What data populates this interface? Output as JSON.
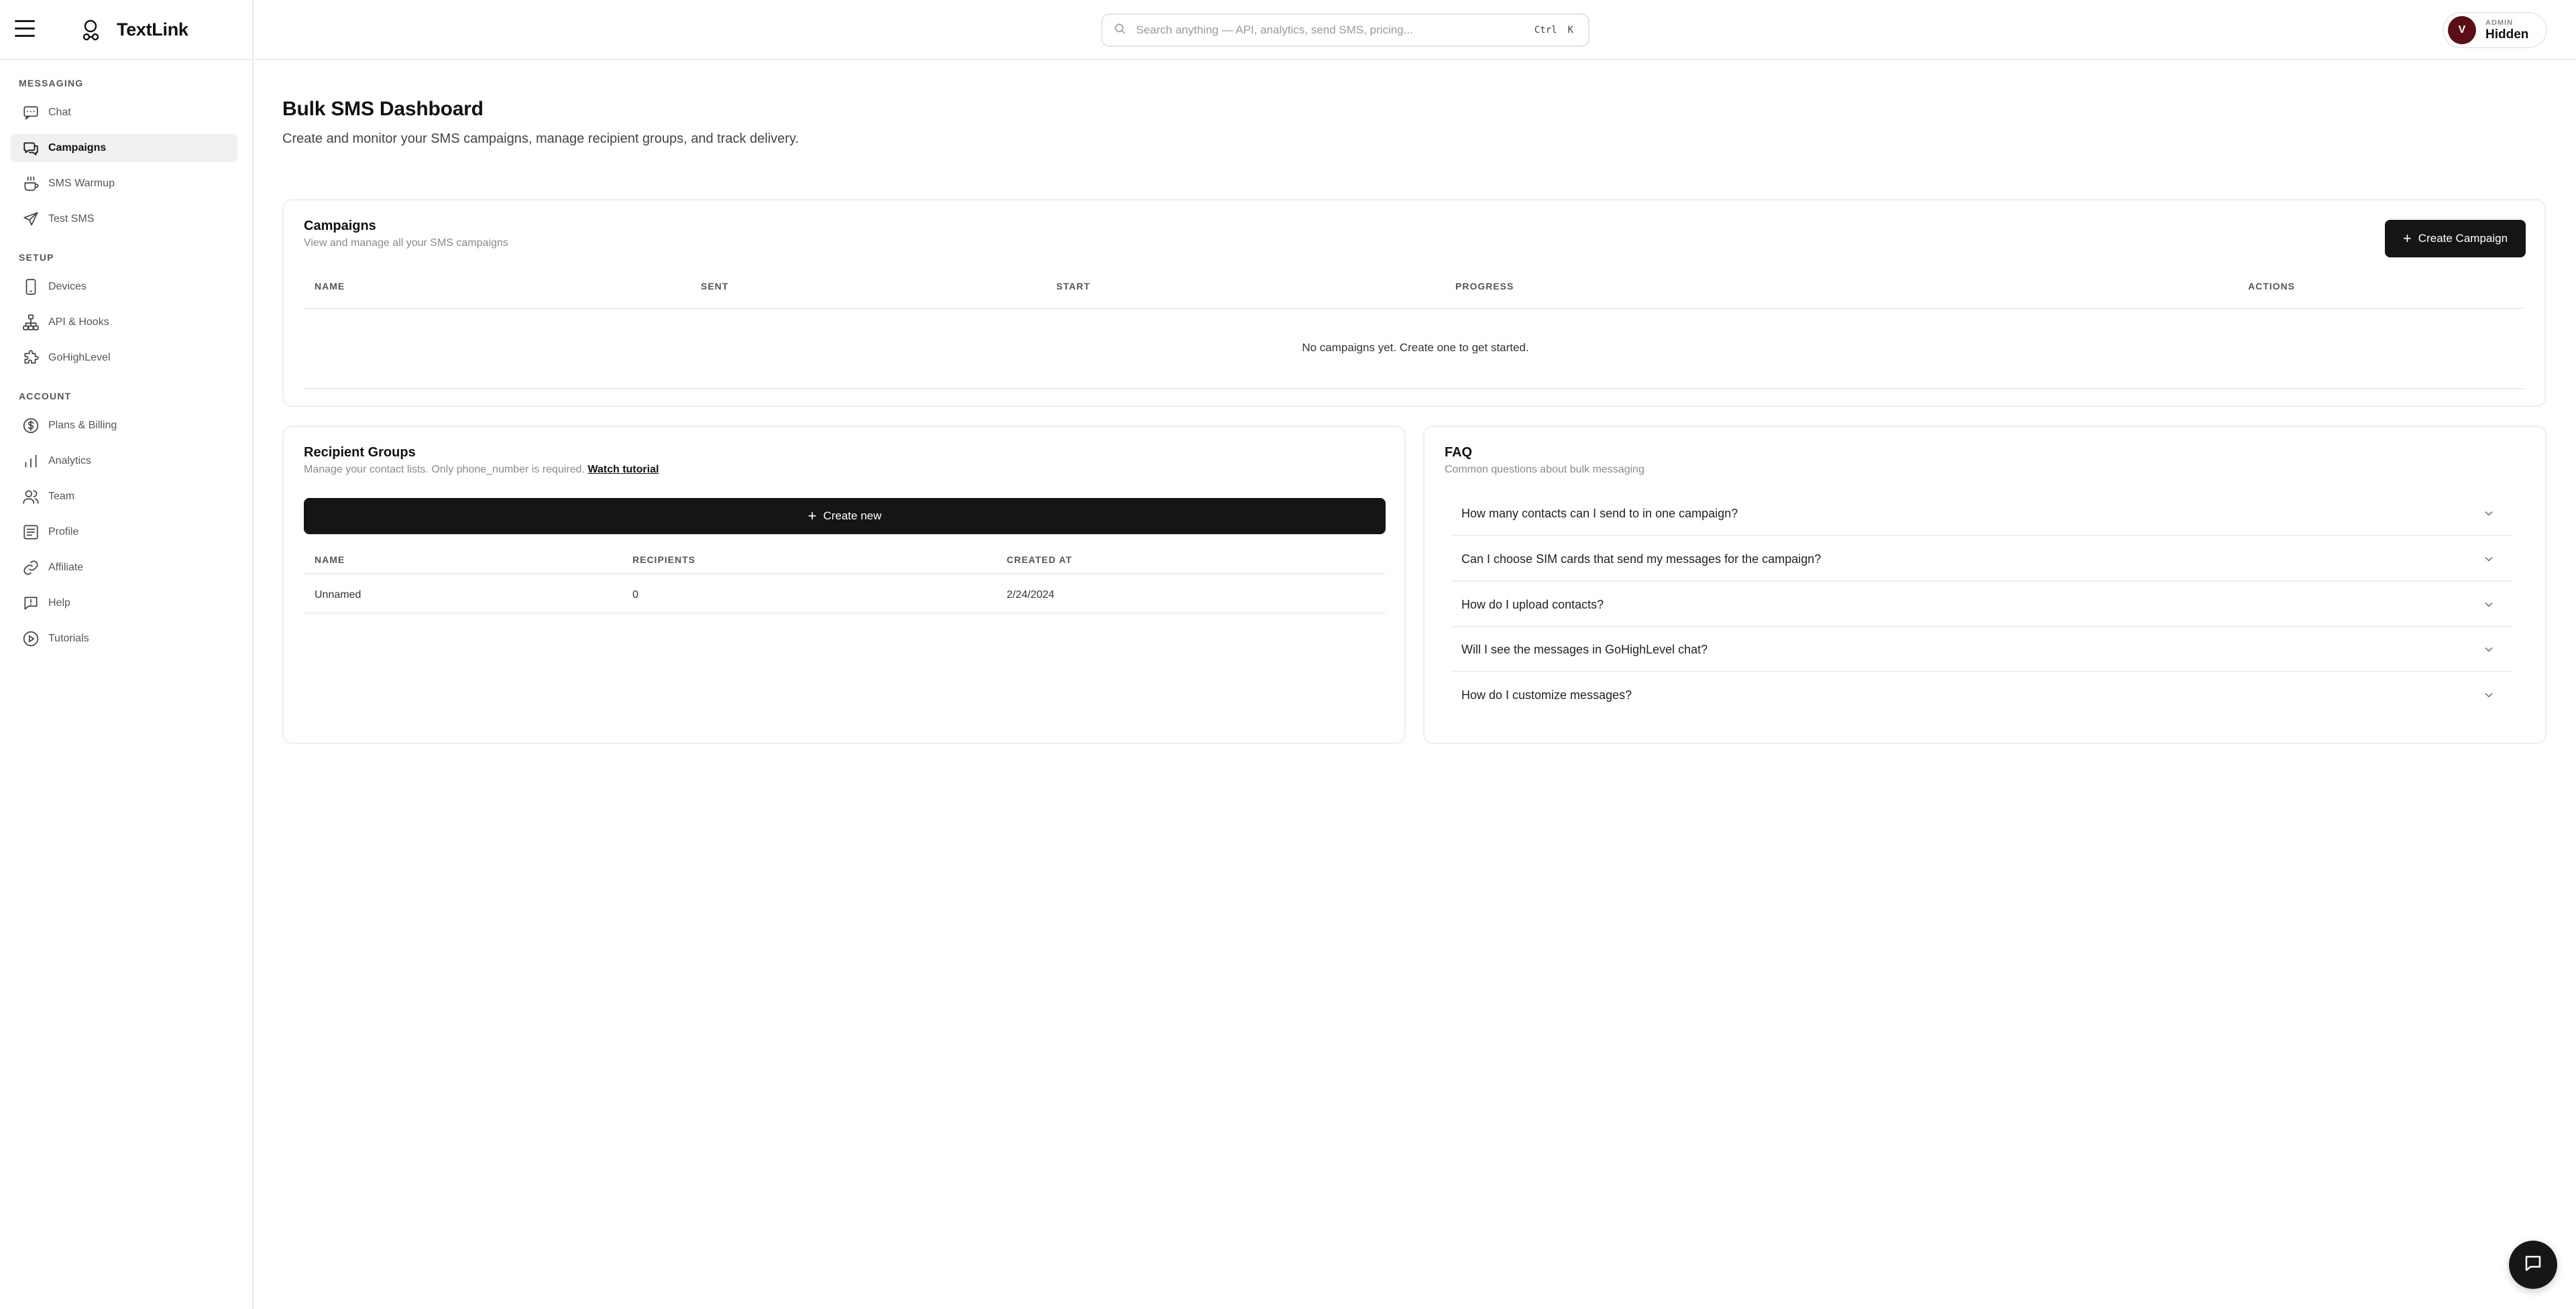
{
  "app": {
    "name": "TextLink"
  },
  "sidebar": {
    "sections": [
      {
        "label": "MESSAGING"
      },
      {
        "label": "SETUP"
      },
      {
        "label": "ACCOUNT"
      }
    ],
    "items": [
      {
        "label": "Chat",
        "icon": "chat-icon"
      },
      {
        "label": "Campaigns",
        "icon": "campaigns-icon",
        "active": true
      },
      {
        "label": "SMS Warmup",
        "icon": "warmup-icon"
      },
      {
        "label": "Test SMS",
        "icon": "send-icon"
      },
      {
        "label": "Devices",
        "icon": "phone-icon"
      },
      {
        "label": "API & Hooks",
        "icon": "network-icon"
      },
      {
        "label": "GoHighLevel",
        "icon": "puzzle-icon"
      },
      {
        "label": "Plans & Billing",
        "icon": "dollar-icon"
      },
      {
        "label": "Analytics",
        "icon": "bar-chart-icon"
      },
      {
        "label": "Team",
        "icon": "team-icon"
      },
      {
        "label": "Profile",
        "icon": "profile-icon"
      },
      {
        "label": "Affiliate",
        "icon": "link-icon"
      },
      {
        "label": "Help",
        "icon": "help-icon"
      },
      {
        "label": "Tutorials",
        "icon": "play-icon"
      }
    ]
  },
  "search": {
    "placeholder": "Search anything — API, analytics, send SMS, pricing...",
    "shortcut_mod": "Ctrl",
    "shortcut_key": "K"
  },
  "user": {
    "initial": "V",
    "role": "ADMIN",
    "name": "Hidden"
  },
  "page": {
    "title": "Bulk SMS Dashboard",
    "subtitle": "Create and monitor your SMS campaigns, manage recipient groups, and track delivery."
  },
  "campaigns": {
    "title": "Campaigns",
    "subtitle": "View and manage all your SMS campaigns",
    "create_label": "Create Campaign",
    "columns": [
      "NAME",
      "SENT",
      "START",
      "PROGRESS",
      "ACTIONS"
    ],
    "empty_text": "No campaigns yet. Create one to get started."
  },
  "recipient_groups": {
    "title": "Recipient Groups",
    "subtitle": "Manage your contact lists. Only phone_number is required.",
    "tutorial_link": "Watch tutorial",
    "create_label": "Create new",
    "columns": [
      "NAME",
      "RECIPIENTS",
      "CREATED AT"
    ],
    "rows": [
      {
        "name": "Unnamed",
        "recipients": "0",
        "created_at": "2/24/2024"
      }
    ]
  },
  "faq": {
    "title": "FAQ",
    "subtitle": "Common questions about bulk messaging",
    "questions": [
      "How many contacts can I send to in one campaign?",
      "Can I choose SIM cards that send my messages for the campaign?",
      "How do I upload contacts?",
      "Will I see the messages in GoHighLevel chat?",
      "How do I customize messages?"
    ]
  },
  "colors": {
    "accent": "#151515",
    "avatar": "#5a0e15",
    "active_nav": "#f0f0f0"
  }
}
